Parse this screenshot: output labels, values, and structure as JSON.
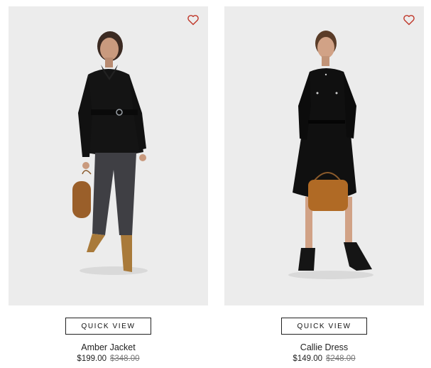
{
  "products": [
    {
      "name": "Amber Jacket",
      "price": "$199.00",
      "original_price": "$348.00",
      "quick_view_label": "QUICK VIEW",
      "wishlist_icon": "heart-outline-icon"
    },
    {
      "name": "Callie Dress",
      "price": "$149.00",
      "original_price": "$248.00",
      "quick_view_label": "QUICK VIEW",
      "wishlist_icon": "heart-outline-icon"
    }
  ],
  "colors": {
    "wishlist_heart": "#c0392b",
    "photo_background": "#ececec",
    "button_border": "#222222"
  }
}
